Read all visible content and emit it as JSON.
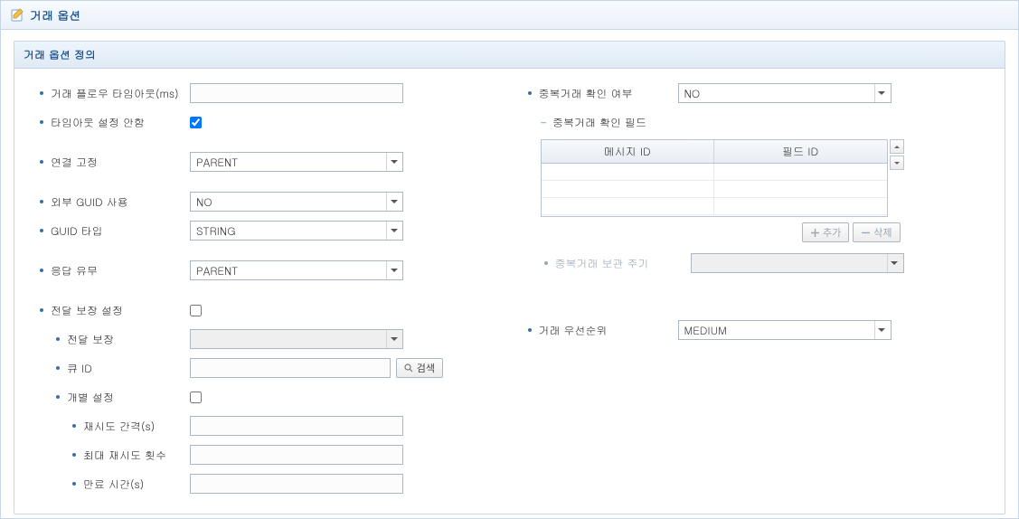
{
  "header": {
    "title": "거래 옵션"
  },
  "section": {
    "title": "거래 옵션 정의"
  },
  "left": {
    "flow_timeout_label": "거래 플로우 타임아웃(ms)",
    "flow_timeout_value": "",
    "timeout_no_set_label": "타임아웃 설정 안함",
    "timeout_no_set_checked": true,
    "conn_fix_label": "연결 고정",
    "conn_fix_value": "PARENT",
    "ext_guid_label": "외부 GUID 사용",
    "ext_guid_value": "NO",
    "guid_type_label": "GUID 타입",
    "guid_type_value": "STRING",
    "response_label": "응답 유무",
    "response_value": "PARENT",
    "delivery_guarantee_set_label": "전달 보장 설정",
    "delivery_guarantee_set_checked": false,
    "delivery_guarantee_label": "전달 보장",
    "delivery_guarantee_value": "",
    "queue_id_label": "큐 ID",
    "queue_id_value": "",
    "search_btn": "검색",
    "indiv_set_label": "개별 설정",
    "indiv_set_checked": false,
    "retry_interval_label": "재시도 간격(s)",
    "retry_interval_value": "",
    "max_retry_label": "최대 재시도 횟수",
    "max_retry_value": "",
    "expire_label": "만료 시간(s)",
    "expire_value": ""
  },
  "right": {
    "dup_check_label": "중복거래 확인 여부",
    "dup_check_value": "NO",
    "dup_field_label": "중복거래 확인 필드",
    "table": {
      "col1": "메시지 ID",
      "col2": "필드 ID"
    },
    "add_btn": "추가",
    "del_btn": "삭제",
    "dup_keep_label": "중복거래 보관 주기",
    "dup_keep_value": "",
    "priority_label": "거래 우선순위",
    "priority_value": "MEDIUM"
  }
}
